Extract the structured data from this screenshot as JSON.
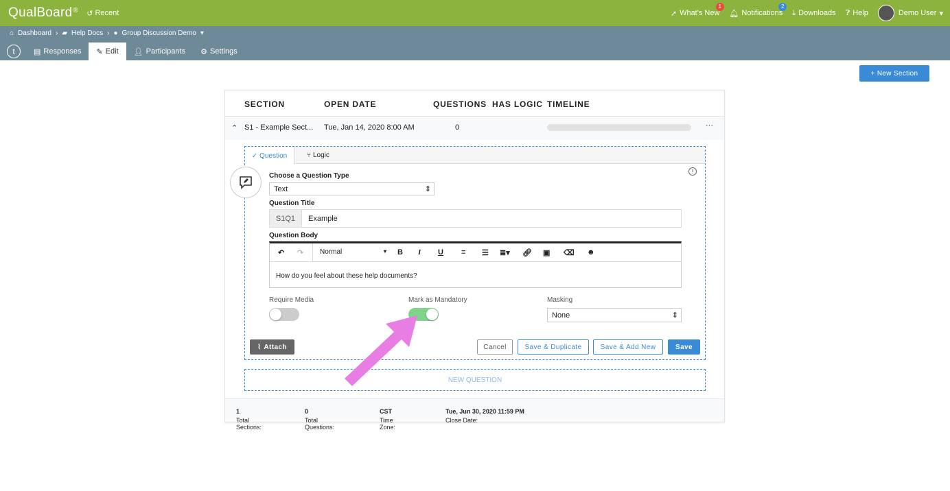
{
  "app": {
    "name": "QualBoard",
    "mark": "®",
    "recent_label": "Recent"
  },
  "topnav": {
    "whats_new": "What's New",
    "whats_new_badge": "1",
    "notifications": "Notifications",
    "notifications_badge": "2",
    "downloads": "Downloads",
    "help": "Help",
    "user": "Demo User"
  },
  "breadcrumb": {
    "items": [
      "Dashboard",
      "Help Docs",
      "Group Discussion Demo"
    ]
  },
  "tabs": [
    {
      "label": "Responses"
    },
    {
      "label": "Edit"
    },
    {
      "label": "Participants"
    },
    {
      "label": "Settings"
    }
  ],
  "new_section_label": "+ New Section",
  "table": {
    "headers": {
      "section": "SECTION",
      "open_date": "OPEN DATE",
      "questions": "QUESTIONS",
      "has_logic": "HAS LOGIC",
      "timeline": "TIMELINE"
    },
    "row": {
      "section": "S1 - Example Sect...",
      "open_date": "Tue, Jan 14, 2020 8:00 AM",
      "questions": "0",
      "menu": "···"
    }
  },
  "question": {
    "tab_question": "Question",
    "tab_logic": "Logic",
    "type_label": "Choose a Question Type",
    "type_value": "Text",
    "title_label": "Question Title",
    "qnum": "S1Q1",
    "title_value": "Example",
    "body_label": "Question Body",
    "format_value": "Normal",
    "body_text": "How do you feel about these help documents?",
    "require_media_label": "Require Media",
    "require_media_on": false,
    "mandatory_label": "Mark as Mandatory",
    "mandatory_on": true,
    "masking_label": "Masking",
    "masking_value": "None"
  },
  "buttons": {
    "attach": "Attach",
    "cancel": "Cancel",
    "save_duplicate": "Save & Duplicate",
    "save_add_new": "Save & Add New",
    "save": "Save"
  },
  "new_question_label": "NEW QUESTION",
  "footer": {
    "total_sections_label": "Total Sections:",
    "total_sections": "1",
    "total_questions_label": "Total Questions:",
    "total_questions": "0",
    "time_zone_label": "Time Zone:",
    "time_zone": "CST",
    "close_date_label": "Close Date:",
    "close_date": "Tue, Jun 30, 2020 11:59 PM"
  },
  "colors": {
    "topbar": "#8db33f",
    "subbar": "#6e8998",
    "accent": "#3a8ad6",
    "toggle_on": "#7fd38a",
    "arrow": "#e87ee3"
  }
}
